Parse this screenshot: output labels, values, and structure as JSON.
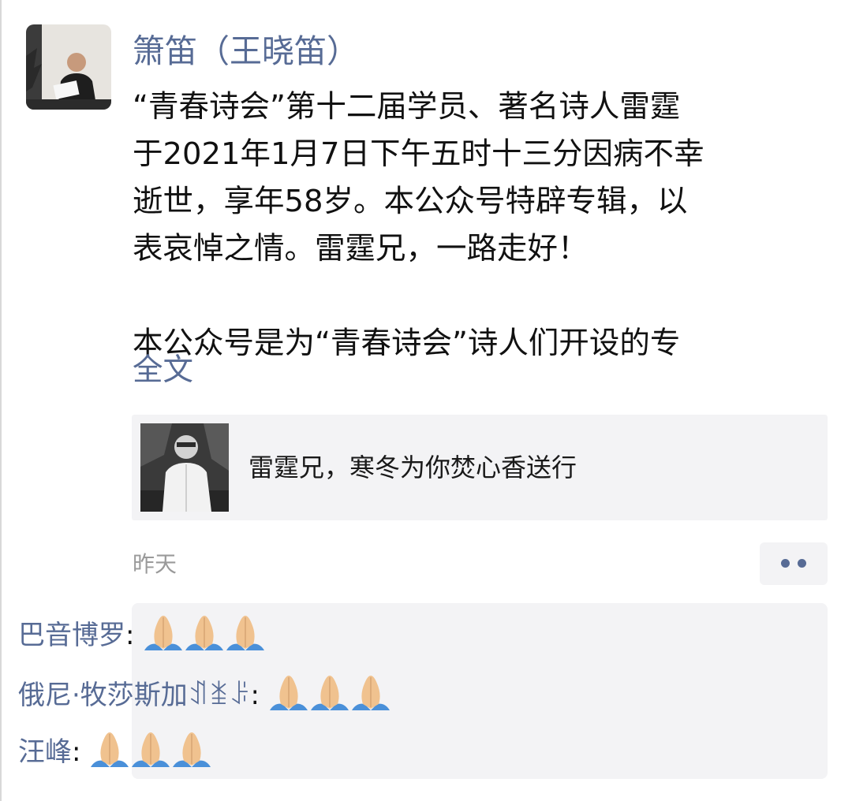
{
  "post": {
    "poster_name": "箫笛（王晓笛）",
    "avatar_icon": "poster-avatar-photo",
    "text_lines": [
      "“青春诗会”第十二届学员、著名诗人雷霆",
      "于2021年1月7日下午五时十三分因病不幸",
      "逝世，享年58岁。本公众号特辟专辑，以",
      "表哀悼之情。雷霆兄，一路走好！",
      "",
      "本公众号是为“青春诗会”诗人们开设的专"
    ],
    "full_text_label": "全文",
    "link_card": {
      "title": "雷霆兄，寒冬为你焚心香送行",
      "thumbnail_icon": "article-thumbnail-photo"
    },
    "timestamp": "昨天",
    "more_button_icon": "more-dots-icon"
  },
  "comments": [
    {
      "author": "巴音博罗",
      "separator": ":",
      "emoji": "🙏🙏🙏"
    },
    {
      "author": "俄尼·牧莎斯加ꀊꁧꌠ",
      "separator": ":",
      "emoji": "🙏🙏🙏"
    },
    {
      "author": "汪峰",
      "separator": ":",
      "emoji": "🙏🙏🙏"
    }
  ],
  "colors": {
    "link_blue": "#576b95",
    "body_text": "#111111",
    "timestamp_gray": "#9a9a9a",
    "panel_bg": "#f3f3f5"
  }
}
